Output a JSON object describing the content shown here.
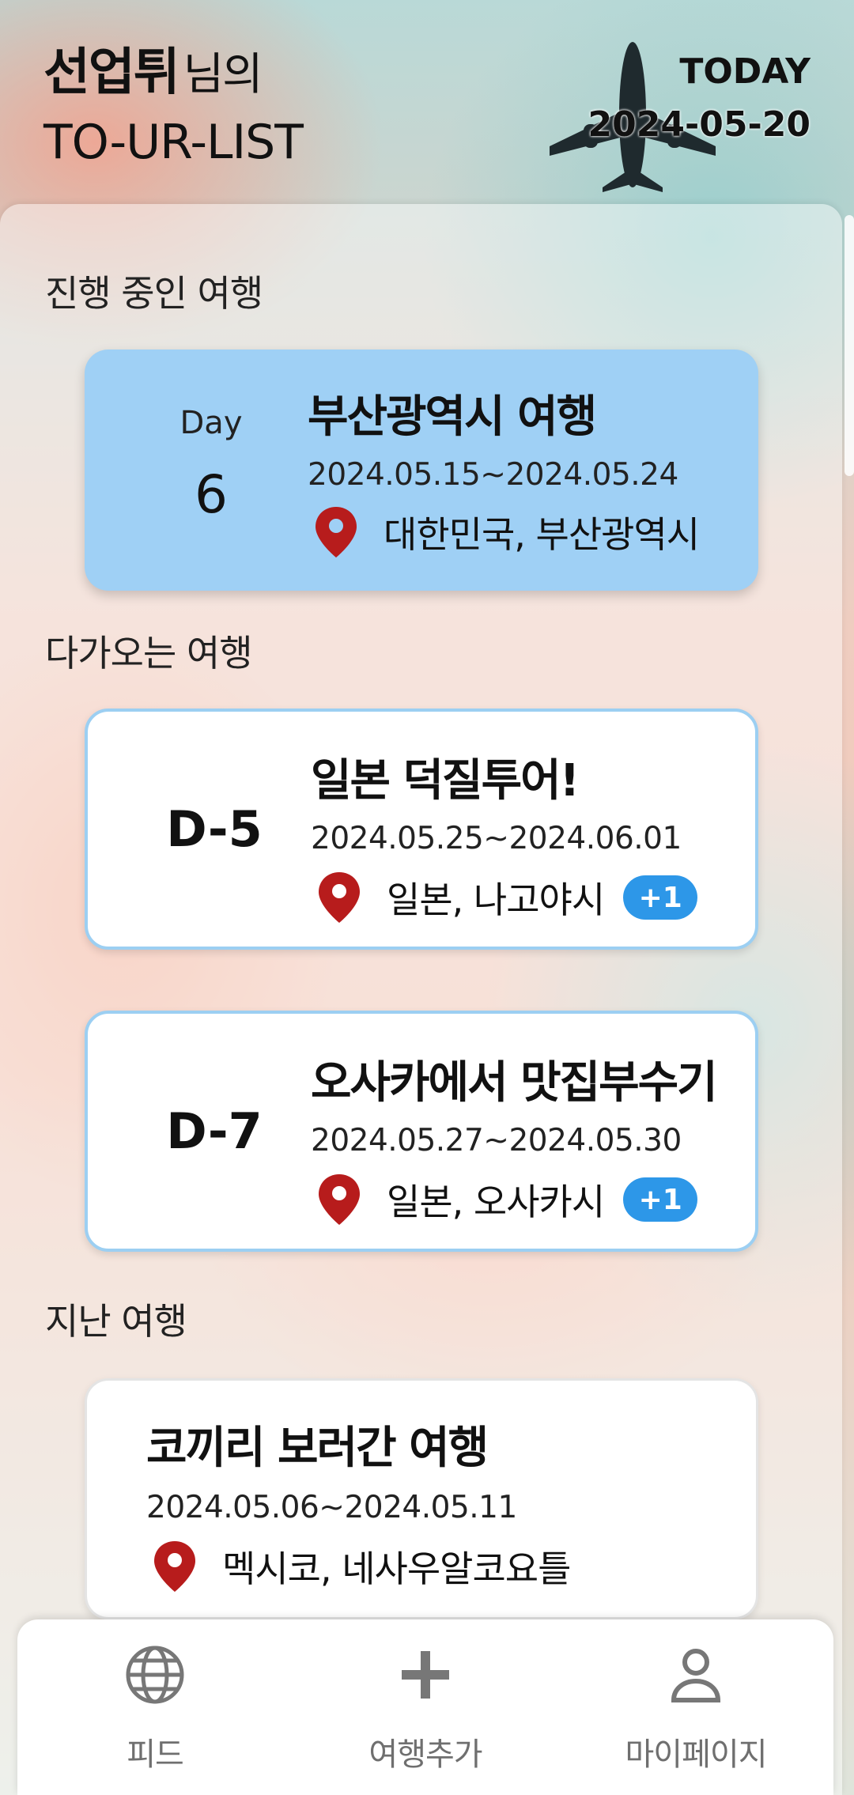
{
  "header": {
    "user_name": "선업튀",
    "user_suffix": "님의",
    "app_title": "TO-UR-LIST",
    "today_label": "TODAY",
    "today_date": "2024-05-20"
  },
  "sections": {
    "ongoing": "진행 중인 여행",
    "upcoming": "다가오는 여행",
    "past": "지난 여행"
  },
  "ongoing_trip": {
    "day_label": "Day",
    "day_number": "6",
    "title": "부산광역시 여행",
    "dates": "2024.05.15~2024.05.24",
    "location": "대한민국, 부산광역시"
  },
  "upcoming_trips": [
    {
      "dday": "D-5",
      "title": "일본 덕질투어!",
      "dates": "2024.05.25~2024.06.01",
      "location": "일본, 나고야시",
      "extra": "+1"
    },
    {
      "dday": "D-7",
      "title": "오사카에서 맛집부수기",
      "dates": "2024.05.27~2024.05.30",
      "location": "일본, 오사카시",
      "extra": "+1"
    }
  ],
  "past_trips": [
    {
      "title": "코끼리 보러간 여행",
      "dates": "2024.05.06~2024.05.11",
      "location": "멕시코, 네사우알코요틀"
    }
  ],
  "nav": {
    "feed": "피드",
    "add_trip": "여행추가",
    "my_page": "마이페이지"
  },
  "colors": {
    "ongoing_card": "#9fd0f5",
    "upcoming_border": "#9ccff2",
    "badge": "#2d97e8",
    "pin": "#b71c1c"
  },
  "icons": {
    "plane": "airplane-icon",
    "pin": "location-pin-icon",
    "feed": "globe-icon",
    "add": "plus-icon",
    "profile": "person-icon"
  }
}
